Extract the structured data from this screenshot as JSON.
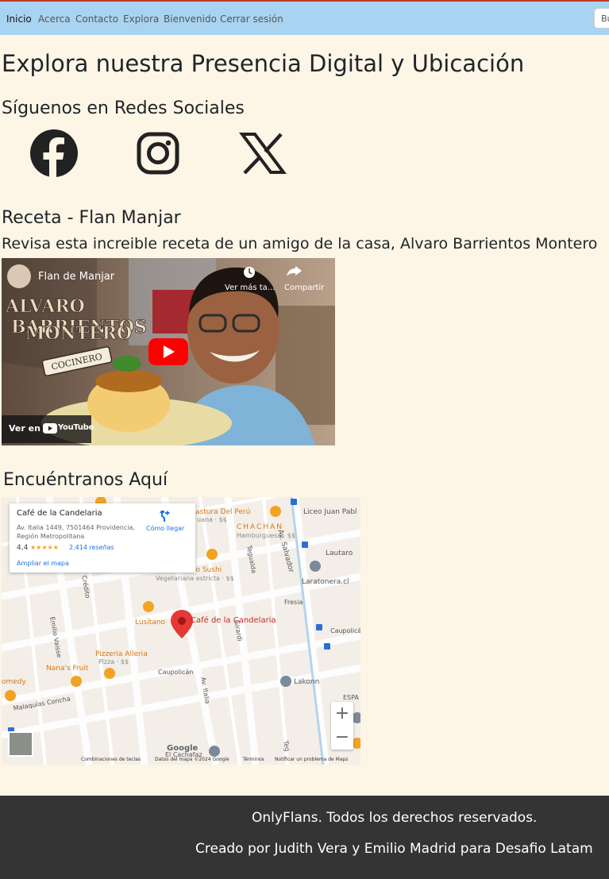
{
  "nav": {
    "items": [
      "Inicio",
      "Acerca",
      "Contacto",
      "Explora",
      "Bienvenido",
      "Cerrar sesión"
    ],
    "search_value": "Bu"
  },
  "page": {
    "title": "Explora nuestra Presencia Digital y Ubicación",
    "social_heading": "Síguenos en Redes Sociales",
    "social_icons": [
      "facebook-icon",
      "instagram-icon",
      "x-icon"
    ],
    "recipe_heading": "Receta - Flan Manjar",
    "recipe_subtitle": "Revisa esta increible receta de un amigo de la casa, Alvaro Barrientos Montero",
    "map_heading": "Encuéntranos Aquí"
  },
  "video": {
    "title": "Flan de Manjar",
    "watch_later": "Ver más ta...",
    "share": "Compartir",
    "watch_on": "Ver en",
    "youtube": "YouTube",
    "overlay_lines": [
      "ALVARO",
      "BARRIENTOS",
      "MONTERO"
    ],
    "ribbon": "COCINERO"
  },
  "map": {
    "place_name": "Café de la Candelaria",
    "address": "Av. Italia 1449, 7501464 Providencia, Región Metropolitana",
    "rating": "4,4",
    "stars": "★★★★★",
    "reviews": "2.414 reseñas",
    "directions": "Cómo llegar",
    "expand": "Ampliar el mapa",
    "labels": {
      "sastre": "astura Del Perú",
      "sastre_sub": "uana · $$",
      "chachan": "CHACHAN",
      "chachan_sub": "Hamburguesa · $$",
      "liceo": "Liceo Juan Pabl",
      "av_salvador": "Av. Salvador",
      "lautaro": "Lautaro",
      "laratonera": "Laratonera.cl",
      "sushi": "mbo Sushi",
      "sushi_sub": "Vegetariana estricta · $$",
      "tegualda": "Tegualda",
      "credito": "Crédito",
      "fresia": "Fresia",
      "lusitano": "Lusitano",
      "cafe": "Café de la Candelaria",
      "emilio_vaisse": "Emilio Vaisse",
      "girardi": "Girardi",
      "caupolican": "Caupolicán",
      "caupolican2": "Caupolicán",
      "pizzeria": "Pizzeria Alleria",
      "pizzeria_sub": "Pizza · $$",
      "nanas": "Nana's Fruit",
      "comedy": "omedy",
      "lakonn": "Lakonn",
      "av_italia": "Av. Italia",
      "malaquias": "Malaquías Concha",
      "espa": "ESPA",
      "el_cachafaz": "El Cachafaz",
      "tegu2": "Teg"
    },
    "zoom_in": "+",
    "zoom_out": "−",
    "google": "Google",
    "attribution": [
      "Combinaciones de teclas",
      "Datos del mapa ©2024 Google",
      "Términos",
      "Notificar un problema de Maps"
    ]
  },
  "footer": {
    "rights": "OnlyFlans. Todos los derechos reservados.",
    "credits": "Creado por Judith Vera y Emilio Madrid para Desafio Latam"
  }
}
